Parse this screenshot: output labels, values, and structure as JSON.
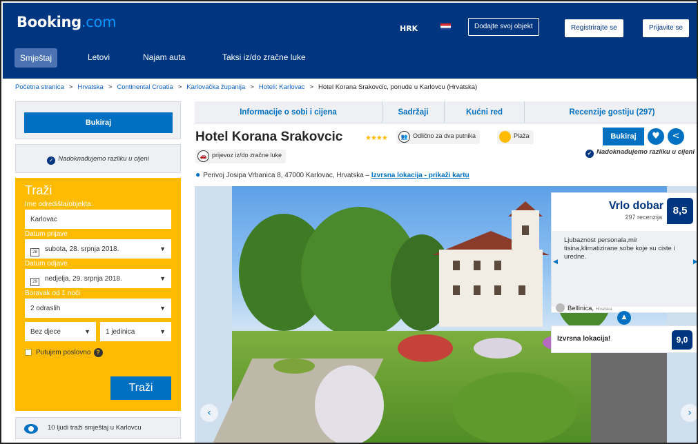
{
  "header": {
    "logo_main": "Booking",
    "logo_tld": ".com",
    "currency": "HRK",
    "add_property": "Dodajte svoj objekt",
    "register": "Registrirajte se",
    "signin": "Prijavite se"
  },
  "nav": {
    "items": [
      "Smještaj",
      "Letovi",
      "Najam auta",
      "Taksi iz/do zračne luke"
    ]
  },
  "breadcrumb": [
    "Početna stranica",
    "Hrvatska",
    "Continental Croatia",
    "Karlovačka županija",
    "Hoteli: Karlovac",
    "Hotel Korana Srakovcic, ponude u Karlovcu (Hrvatska)"
  ],
  "sidebar": {
    "book_label": "Bukiraj",
    "price_match": "Nadoknađujemo razliku u cijeni",
    "search": {
      "title": "Traži",
      "dest_label": "Ime odredišta/objekta:",
      "dest_value": "Karlovac",
      "checkin_label": "Datum prijave",
      "checkin_value": "subota, 28. srpnja 2018.",
      "checkin_day": "28",
      "checkout_label": "Datum odjave",
      "checkout_value": "nedjelja, 29. srpnja 2018.",
      "checkout_day": "29",
      "stay_label": "Boravak od 1 noći",
      "adults": "2 odraslih",
      "children": "Bez djece",
      "units": "1 jedinica",
      "business": "Putujem poslovno",
      "submit": "Traži"
    },
    "people_text": "10 ljudi traži smještaj u Karlovcu"
  },
  "tabs": [
    "Informacije o sobi i cijena",
    "Sadržaji",
    "Kućni red",
    "Recenzije gostiju (297)"
  ],
  "hotel": {
    "name": "Hotel Korana Srakovcic",
    "stars": "★★★★",
    "tag_couples": "Odlično za dva putnika",
    "tag_beach": "Plaža",
    "tag_transfer": "prijevoz iz/do zračne luke",
    "book": "Bukiraj",
    "price_match": "Nadoknađujemo razliku u cijeni",
    "address": "Perivoj Josipa Vrbanica 8, 47000 Karlovac, Hrvatska –",
    "location_link": "Izvrsna lokacija - prikaži kartu"
  },
  "review": {
    "label": "Vrlo dobar",
    "count": "297 recenzija",
    "score": "8,5",
    "quote": "Ljubaznost personala,mir tisina,klimatizirane sobe koje su ciste i uredne.",
    "author": "Bellinica,",
    "country": "Hrvatska"
  },
  "location": {
    "label": "Izvrsna lokacija!",
    "score": "9,0"
  },
  "colors": {
    "brand": "#003580",
    "accent": "#0071c2",
    "search": "#febb02"
  }
}
